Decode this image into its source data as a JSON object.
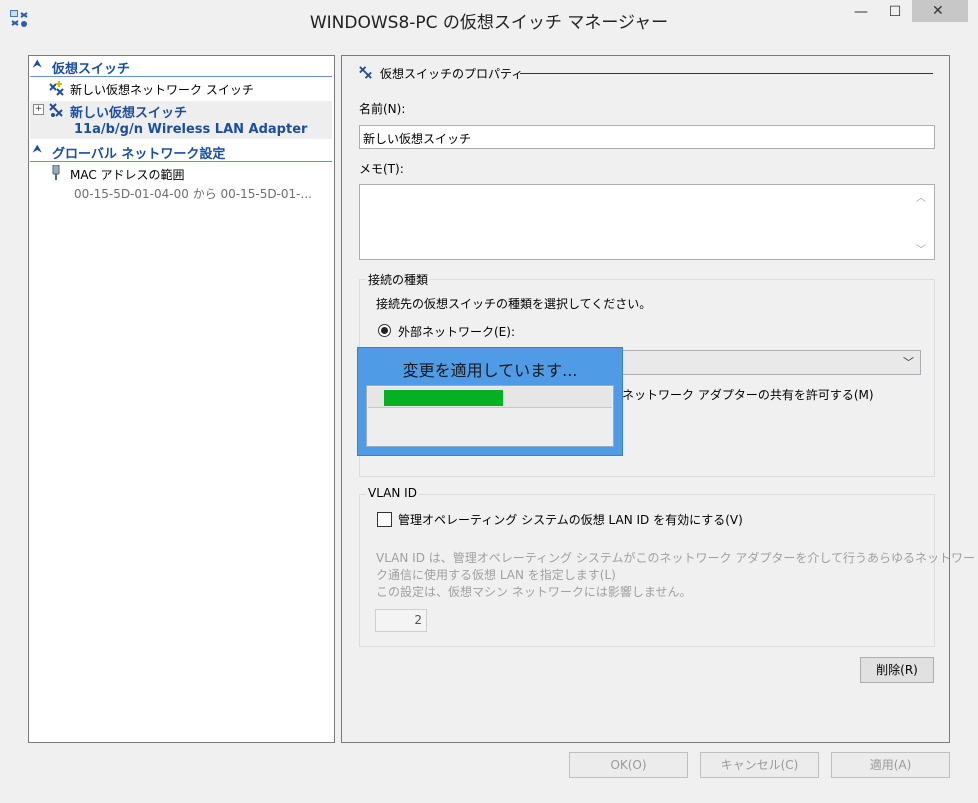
{
  "window": {
    "title": "WINDOWS8-PC の仮想スイッチ マネージャー",
    "minimize_glyph": "—",
    "maximize_glyph": "☐",
    "close_glyph": "✕"
  },
  "tree": {
    "virtual_switches_header": "仮想スイッチ",
    "new_network_switch": "新しい仮想ネットワーク スイッチ",
    "switch_name": "新しい仮想スイッチ",
    "switch_adapter": "11a/b/g/n Wireless LAN Adapter",
    "global_settings_header": "グローバル ネットワーク設定",
    "mac_range_label": "MAC アドレスの範囲",
    "mac_range_value": "00-15-5D-01-04-00 から 00-15-5D-01-..."
  },
  "props": {
    "section_title": "仮想スイッチのプロパティ",
    "name_label": "名前(N):",
    "name_value": "新しい仮想スイッチ",
    "memo_label": "メモ(T):",
    "memo_value": "",
    "connection_group": "接続の種類",
    "connection_desc": "接続先の仮想スイッチの種類を選択してください。",
    "external_network": "外部ネットワーク(E):",
    "adapter_value": "",
    "allow_share": "ネットワーク アダプターの共有を許可する(M)",
    "vlan_group": "VLAN ID",
    "vlan_enable": "管理オペレーティング システムの仮想 LAN ID を有効にする(V)",
    "vlan_desc1": "VLAN ID は、管理オペレーティング システムがこのネットワーク アダプターを介して行うあらゆるネットワー",
    "vlan_desc2": "ク通信に使用する仮想 LAN を指定します(L)",
    "vlan_desc3": "この設定は、仮想マシン ネットワークには影響しません。",
    "vlan_value": "2",
    "delete_button": "削除(R)"
  },
  "footer": {
    "ok": "OK(O)",
    "cancel": "キャンセル(C)",
    "apply": "適用(A)"
  },
  "overlay": {
    "message": "変更を適用しています...",
    "progress": 0.52
  },
  "colors": {
    "accent": "#1a4e9e",
    "overlay_bg": "#4f9be5",
    "progress_fill": "#06b025"
  }
}
